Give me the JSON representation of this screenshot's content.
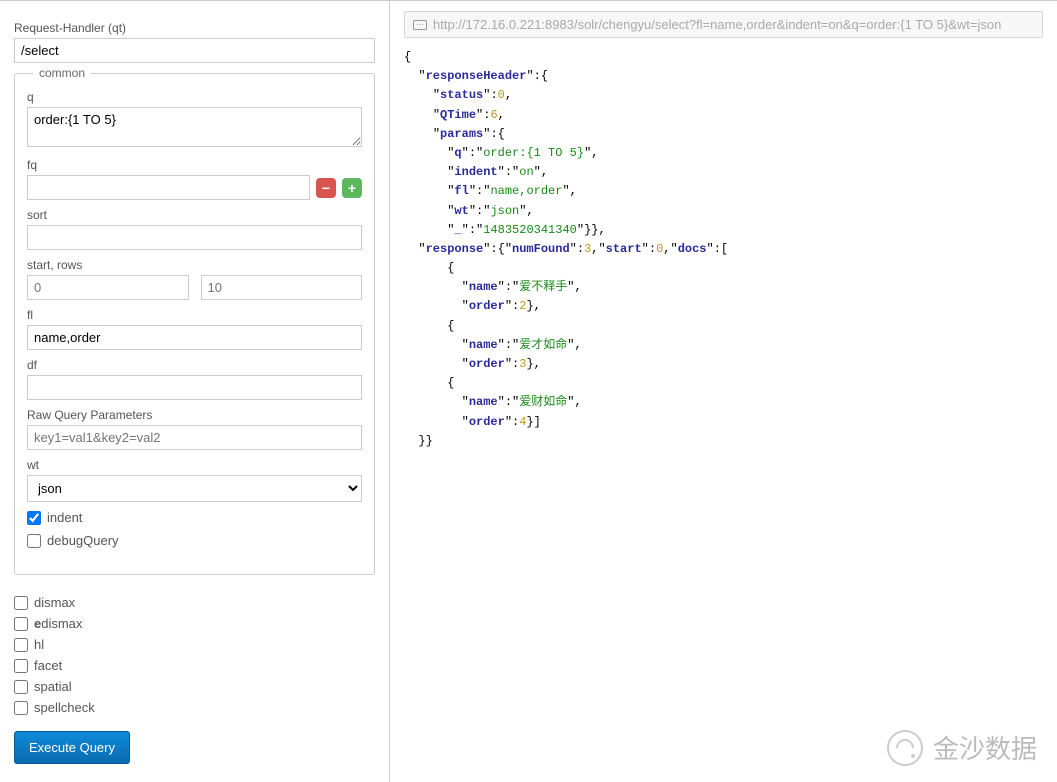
{
  "form": {
    "qt_label": "Request-Handler (qt)",
    "qt_value": "/select",
    "common_legend": "common",
    "q_label": "q",
    "q_value": "order:{1 TO 5}",
    "fq_label": "fq",
    "fq_value": "",
    "minus_label": "−",
    "plus_label": "+",
    "sort_label": "sort",
    "sort_value": "",
    "start_rows_label": "start, rows",
    "start_placeholder": "0",
    "rows_placeholder": "10",
    "fl_label": "fl",
    "fl_value": "name,order",
    "df_label": "df",
    "df_value": "",
    "raw_label": "Raw Query Parameters",
    "raw_placeholder": "key1=val1&key2=val2",
    "wt_label": "wt",
    "wt_value": "json",
    "indent_label": "indent",
    "indent_checked": true,
    "debug_label": "debugQuery",
    "debug_checked": false,
    "opts": {
      "dismax": {
        "label": "dismax",
        "checked": false
      },
      "edismax": {
        "label_pre": "e",
        "label_rest": "dismax",
        "checked": false
      },
      "hl": {
        "label": "hl",
        "checked": false
      },
      "facet": {
        "label": "facet",
        "checked": false
      },
      "spatial": {
        "label": "spatial",
        "checked": false
      },
      "spellcheck": {
        "label": "spellcheck",
        "checked": false
      }
    },
    "execute_label": "Execute Query"
  },
  "result": {
    "url": "http://172.16.0.221:8983/solr/chengyu/select?fl=name,order&indent=on&q=order:{1 TO 5}&wt=json",
    "json": {
      "k_responseHeader": "responseHeader",
      "k_status": "status",
      "v_status": "0",
      "k_QTime": "QTime",
      "v_QTime": "6",
      "k_params": "params",
      "k_q": "q",
      "v_q": "order:{1 TO 5}",
      "k_indent": "indent",
      "v_indent": "on",
      "k_fl": "fl",
      "v_fl": "name,order",
      "k_wt": "wt",
      "v_wt": "json",
      "k_ts": "_",
      "v_ts": "1483520341340",
      "k_response": "response",
      "k_numFound": "numFound",
      "v_numFound": "3",
      "k_start": "start",
      "v_start": "0",
      "k_docs": "docs",
      "k_name": "name",
      "k_order": "order",
      "doc1_name": "爱不释手",
      "doc1_order": "2",
      "doc2_name": "爱才如命",
      "doc2_order": "3",
      "doc3_name": "爱财如命",
      "doc3_order": "4"
    }
  },
  "watermark_text": "金沙数据"
}
